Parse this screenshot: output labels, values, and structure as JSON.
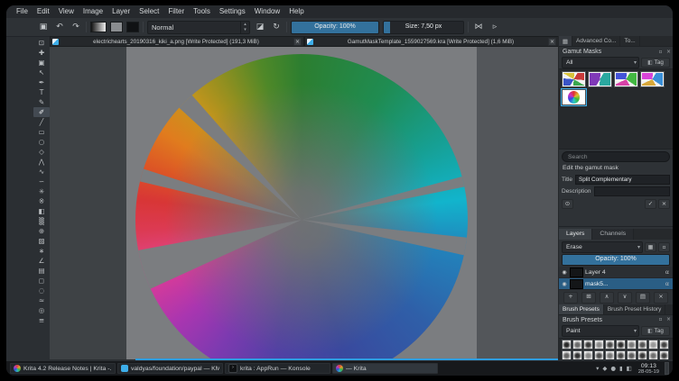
{
  "colors": {
    "accent": "#3daee9",
    "slider_blue": "#33719c",
    "selection_blue": "#2a5e85",
    "canvas_gray": "#7b7d80"
  },
  "menu": {
    "items": [
      "File",
      "Edit",
      "View",
      "Image",
      "Layer",
      "Select",
      "Filter",
      "Tools",
      "Settings",
      "Window",
      "Help"
    ]
  },
  "toolbar": {
    "blend_mode_value": "Normal",
    "opacity_label": "Opacity: 100%",
    "size_label": "Size: 7,50 px"
  },
  "icons": {
    "save_doc": "▣",
    "undo": "↶",
    "redo": "↷",
    "eraser": "◪",
    "reload": "↻",
    "mirror": "⋈",
    "more": "▹",
    "spin_up": "▴",
    "spin_down": "▾",
    "combo_arrow": "▾",
    "close": "×",
    "dock_grid": "▦",
    "float": "▫",
    "eye": "◉",
    "alpha": "α",
    "preview": "⊙",
    "save_check": "✓",
    "cancel": "×",
    "tag": "◧"
  },
  "toolbox": {
    "tools": [
      {
        "name": "transform-tool",
        "glyph": "⊡"
      },
      {
        "name": "move-tool",
        "glyph": "✚"
      },
      {
        "name": "crop-tool",
        "glyph": "▣"
      },
      {
        "name": "select-shapes-tool",
        "glyph": "↖"
      },
      {
        "name": "calligraphy-tool",
        "glyph": "✒"
      },
      {
        "name": "text-tool",
        "glyph": "T"
      },
      {
        "name": "edit-shapes-tool",
        "glyph": "✎"
      },
      {
        "name": "freehand-brush-tool",
        "glyph": "✐",
        "active": true
      },
      {
        "name": "line-tool",
        "glyph": "╱"
      },
      {
        "name": "rectangle-tool",
        "glyph": "▭"
      },
      {
        "name": "ellipse-tool",
        "glyph": "○"
      },
      {
        "name": "polygon-tool",
        "glyph": "◇"
      },
      {
        "name": "polyline-tool",
        "glyph": "⋀"
      },
      {
        "name": "bezier-curve-tool",
        "glyph": "∿"
      },
      {
        "name": "freehand-path-tool",
        "glyph": "∽"
      },
      {
        "name": "dynamic-brush-tool",
        "glyph": "✳"
      },
      {
        "name": "multibrush-tool",
        "glyph": "※"
      },
      {
        "name": "fill-tool",
        "glyph": "◧"
      },
      {
        "name": "gradient-tool",
        "glyph": "▒"
      },
      {
        "name": "color-sampler-tool",
        "glyph": "⊕"
      },
      {
        "name": "smart-patch-tool",
        "glyph": "▨"
      },
      {
        "name": "assistants-tool",
        "glyph": "∗"
      },
      {
        "name": "measure-tool",
        "glyph": "∠"
      },
      {
        "name": "reference-images-tool",
        "glyph": "▤"
      },
      {
        "name": "rectangular-selection-tool",
        "glyph": "◻"
      },
      {
        "name": "elliptical-selection-tool",
        "glyph": "◌"
      },
      {
        "name": "freehand-selection-tool",
        "glyph": "≈"
      },
      {
        "name": "zoom-tool",
        "glyph": "◎"
      },
      {
        "name": "pan-tool",
        "glyph": "≡"
      }
    ]
  },
  "windows": [
    {
      "title": "electrichearts_20190316_kiki_a.png [Write Protected] (191,3 MiB)"
    },
    {
      "title": "GamutMaskTemplate_1559027569.kra [Write Protected] (1,6 MiB)"
    }
  ],
  "canvas": {
    "wheel_hue_stops": [
      [
        0,
        "#2c7e30"
      ],
      [
        9,
        "#1f8c52"
      ],
      [
        17,
        "#16a095"
      ],
      [
        23,
        "#12b4cc"
      ],
      [
        28,
        "#2283bb"
      ],
      [
        36,
        "#2f5fa8"
      ],
      [
        45,
        "#39499e"
      ],
      [
        53,
        "#5240a4"
      ],
      [
        59,
        "#7c3ab0"
      ],
      [
        64,
        "#a936b0"
      ],
      [
        68,
        "#d03a9c"
      ],
      [
        71,
        "#df4480"
      ],
      [
        74,
        "#dc3a52"
      ],
      [
        77,
        "#d83636"
      ],
      [
        80,
        "#dc5226"
      ],
      [
        84,
        "#e07c1e"
      ],
      [
        88,
        "#c8951c"
      ],
      [
        92,
        "#8f8f20"
      ],
      [
        96,
        "#4f8828"
      ],
      [
        100,
        "#2c7e30"
      ]
    ]
  },
  "gamut_docker": {
    "tabs": [
      "Advanced Co...",
      "To..."
    ],
    "title": "Gamut Masks",
    "filter_value": "All",
    "tag_label": "Tag",
    "search_placeholder": "Search",
    "edit_section_label": "Edit the gamut mask",
    "title_field_label": "Title",
    "title_field_value": "Split Complementary",
    "description_field_label": "Description",
    "description_field_value": "",
    "masks": [
      {
        "name": "gamut-mask-1",
        "colors": [
          "#c83a3a",
          "#3aa84e",
          "#3a55c8",
          "#d8c23a"
        ]
      },
      {
        "name": "gamut-mask-2",
        "colors": [
          "#2aa8a0",
          "#8039b8"
        ]
      },
      {
        "name": "gamut-mask-3",
        "colors": [
          "#42b842",
          "#d843a8",
          "#4353d8"
        ]
      },
      {
        "name": "gamut-mask-4",
        "colors": [
          "#3a8fd8",
          "#d8a83a",
          "#d843d8"
        ]
      },
      {
        "name": "gamut-mask-5",
        "wheel": true,
        "selected": true
      }
    ]
  },
  "layers_docker": {
    "tabs": [
      "Layers",
      "Channels"
    ],
    "blend_mode_value": "Erase",
    "opacity_label": "Opacity: 100%",
    "layers": [
      {
        "name": "Layer 4",
        "selected": false
      },
      {
        "name": "mask5...",
        "selected": true
      }
    ],
    "buttons": [
      {
        "name": "add-layer-button",
        "glyph": "+"
      },
      {
        "name": "duplicate-layer-button",
        "glyph": "⊞"
      },
      {
        "name": "move-layer-up-button",
        "glyph": "∧"
      },
      {
        "name": "move-layer-down-button",
        "glyph": "∨"
      },
      {
        "name": "layer-properties-button",
        "glyph": "▤"
      },
      {
        "name": "delete-layer-button",
        "glyph": "×"
      }
    ]
  },
  "brush_docker": {
    "tabs": [
      "Brush Presets",
      "Brush Preset History"
    ],
    "title": "Brush Presets",
    "filter_value": "Paint",
    "tag_label": "Tag",
    "preset_tones": [
      "#2a2a2a",
      "#6b6b6b",
      "#3a3a3a",
      "#8a8a8a",
      "#4a4a4a",
      "#2f2f2f",
      "#7a7a7a",
      "#555555",
      "#9a9a9a",
      "#444444",
      "#666666",
      "#333333",
      "#888888",
      "#515151",
      "#777777",
      "#494949",
      "#5f5f5f",
      "#383838",
      "#707070",
      "#424242",
      "#9f9f9f",
      "#585858",
      "#808080",
      "#4f4f4f",
      "#929292",
      "#5a5a5a",
      "#868686",
      "#6f6f6f",
      "#616161",
      "#747474"
    ]
  },
  "taskbar": {
    "items": [
      {
        "label": "Krita 4.2 Release Notes | Krita -...",
        "icon": "krita",
        "active": false
      },
      {
        "label": "valdyas/foundation/paypal — KM...",
        "icon": "kmail",
        "active": false
      },
      {
        "label": "krita : AppRun — Konsole",
        "icon": "konsole",
        "active": false
      },
      {
        "label": "— Krita",
        "icon": "krita",
        "active": true
      }
    ],
    "tray_icons": [
      "▾",
      "◆",
      "●",
      "▮",
      "◧"
    ],
    "clock_time": "09:13",
    "clock_date": "28-05-19"
  }
}
